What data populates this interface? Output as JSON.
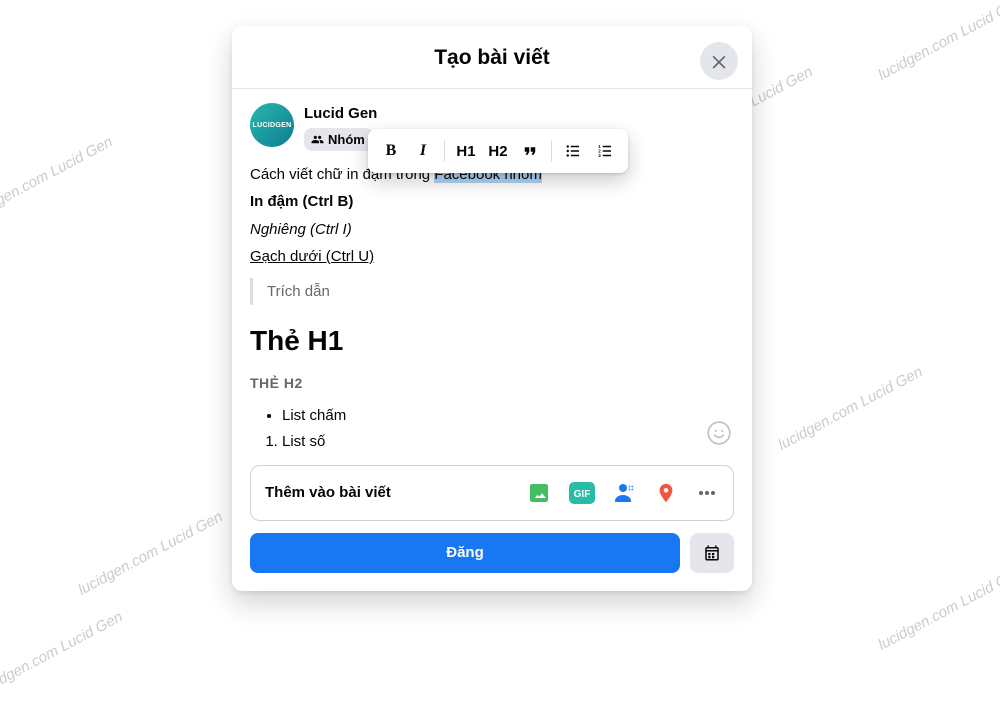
{
  "header": {
    "title": "Tạo bài viết"
  },
  "author": {
    "name": "Lucid Gen",
    "avatar_text": "LUCIDGEN",
    "audience": "Nhóm"
  },
  "toolbar": {
    "bold": "B",
    "italic": "I",
    "h1": "H1",
    "h2": "H2"
  },
  "editor": {
    "line_plain_prefix": "Cách viết chữ in đậm trong ",
    "line_plain_selected": "Facebook nhóm",
    "line_bold": "In đậm (Ctrl B)",
    "line_italic": "Nghiêng (Ctrl I)",
    "line_underline": "Gạch dưới (Ctrl U)",
    "quote": "Trích dẫn",
    "h1": "Thẻ H1",
    "h2": "THẺ H2",
    "bullet_item": "List chấm",
    "number_item": "List số"
  },
  "add_bar": {
    "label": "Thêm vào bài viết"
  },
  "footer": {
    "post": "Đăng"
  },
  "watermark": "lucidgen.com   Lucid Gen"
}
